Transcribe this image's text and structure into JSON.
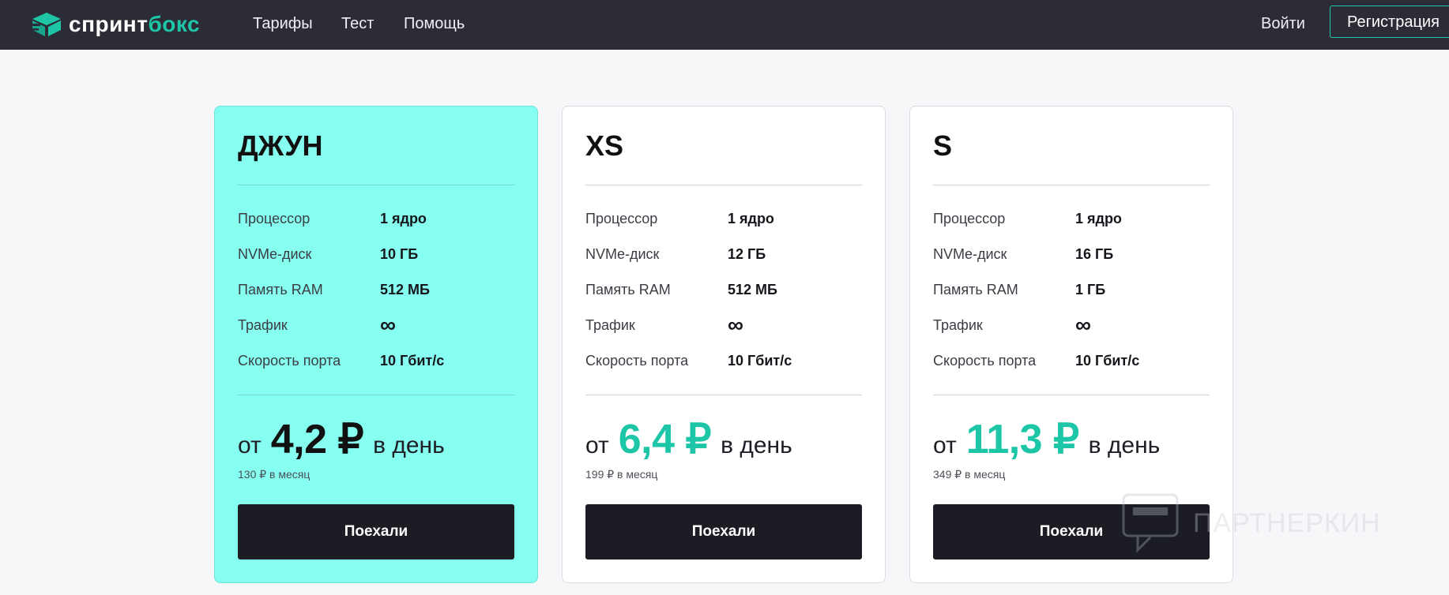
{
  "nav": {
    "logo_part1": "спринт",
    "logo_part2": "бокс",
    "links": [
      "Тарифы",
      "Тест",
      "Помощь"
    ],
    "login": "Войти",
    "register": "Регистрация"
  },
  "labels": {
    "cpu": "Процессор",
    "disk": "NVMe-диск",
    "ram": "Память RAM",
    "traffic": "Трафик",
    "port": "Скорость порта",
    "from": "от",
    "per_day": "в день",
    "button": "Поехали"
  },
  "plans": [
    {
      "name": "ДЖУН",
      "cpu": "1 ядро",
      "disk": "10 ГБ",
      "ram": "512 МБ",
      "traffic": "∞",
      "port": "10 Гбит/с",
      "price": "4,2 ₽",
      "monthly": "130 ₽ в месяц"
    },
    {
      "name": "XS",
      "cpu": "1 ядро",
      "disk": "12 ГБ",
      "ram": "512 МБ",
      "traffic": "∞",
      "port": "10 Гбит/с",
      "price": "6,4 ₽",
      "monthly": "199 ₽ в месяц"
    },
    {
      "name": "S",
      "cpu": "1 ядро",
      "disk": "16 ГБ",
      "ram": "1 ГБ",
      "traffic": "∞",
      "port": "10 Гбит/с",
      "price": "11,3 ₽",
      "monthly": "349 ₽ в месяц"
    }
  ],
  "watermark": "ПАРТНЕРКИН",
  "colors": {
    "accent": "#1ec6a8",
    "nav_bg": "#2b2c35",
    "highlight_card": "#87fff0",
    "button_bg": "#1b1c24"
  }
}
